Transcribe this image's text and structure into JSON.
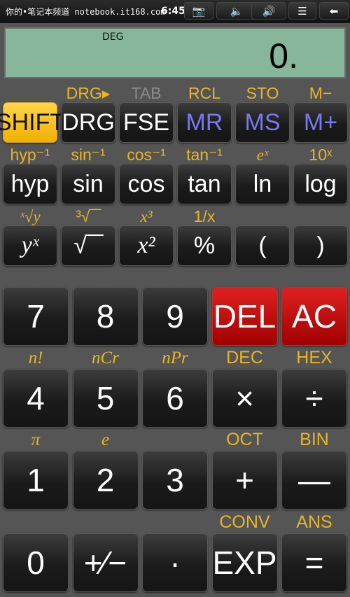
{
  "status_bar": {
    "watermark": "你的•笔记本频道 notebook.it168.com",
    "time": "6:45",
    "buttons": [
      {
        "name": "camera-icon",
        "glyph": "📷"
      },
      {
        "name": "volume-down-icon",
        "glyph": "🔈"
      },
      {
        "name": "volume-up-icon",
        "glyph": "🔊"
      },
      {
        "name": "menu-icon",
        "glyph": "☰"
      },
      {
        "name": "back-icon",
        "glyph": "⬅"
      }
    ]
  },
  "display": {
    "mode": "DEG",
    "value": "0."
  },
  "colors": {
    "shift_label": "#e8b524",
    "shift_button": "#f5bd15",
    "memory_text": "#7878f0",
    "delete_buttons": "#c00000",
    "lcd": "#87b69a"
  },
  "function_rows": [
    [
      {
        "label": "SHIFT",
        "style": "yellow",
        "shift": ""
      },
      {
        "label": "DRG",
        "shift": "DRG▸"
      },
      {
        "label": "FSE",
        "shift": "TAB",
        "shift_style": "grey"
      },
      {
        "label": "MR",
        "style": "blue",
        "shift": "RCL"
      },
      {
        "label": "MS",
        "style": "blue",
        "shift": "STO"
      },
      {
        "label": "M+",
        "style": "blue",
        "shift": "M−"
      }
    ],
    [
      {
        "label": "hyp",
        "shift": "hyp⁻¹"
      },
      {
        "label": "sin",
        "shift": "sin⁻¹"
      },
      {
        "label": "cos",
        "shift": "cos⁻¹"
      },
      {
        "label": "tan",
        "shift": "tan⁻¹"
      },
      {
        "label": "ln",
        "shift": "eˣ",
        "shift_italic": true
      },
      {
        "label": "log",
        "shift": "10ˣ"
      }
    ],
    [
      {
        "label": "yˣ",
        "italic": true,
        "shift": "ˣ√y",
        "shift_italic": true
      },
      {
        "label": "√‾‾",
        "shift": "³√‾‾"
      },
      {
        "label": "x²",
        "italic": true,
        "shift": "x³",
        "shift_italic": true
      },
      {
        "label": "%",
        "shift": "1/x"
      },
      {
        "label": "(",
        "shift": ""
      },
      {
        "label": ")",
        "shift": ""
      }
    ]
  ],
  "number_rows": [
    [
      {
        "label": "7",
        "shift": ""
      },
      {
        "label": "8",
        "shift": ""
      },
      {
        "label": "9",
        "shift": ""
      },
      {
        "label": "DEL",
        "style": "red",
        "shift": ""
      },
      {
        "label": "AC",
        "style": "red",
        "shift": ""
      }
    ],
    [
      {
        "label": "4",
        "shift": "n!",
        "shift_italic": true
      },
      {
        "label": "5",
        "shift": "nCr",
        "shift_italic": true
      },
      {
        "label": "6",
        "shift": "nPr",
        "shift_italic": true
      },
      {
        "label": "×",
        "shift": "DEC"
      },
      {
        "label": "÷",
        "shift": "HEX"
      }
    ],
    [
      {
        "label": "1",
        "shift": "π",
        "shift_italic": true
      },
      {
        "label": "2",
        "shift": "e",
        "shift_italic": true
      },
      {
        "label": "3",
        "shift": ""
      },
      {
        "label": "+",
        "shift": "OCT"
      },
      {
        "label": "—",
        "shift": "BIN"
      }
    ],
    [
      {
        "label": "0",
        "shift": ""
      },
      {
        "label": "+⁄−",
        "shift": ""
      },
      {
        "label": "·",
        "shift": ""
      },
      {
        "label": "EXP",
        "shift": "CONV"
      },
      {
        "label": "=",
        "shift": "ANS"
      }
    ]
  ]
}
